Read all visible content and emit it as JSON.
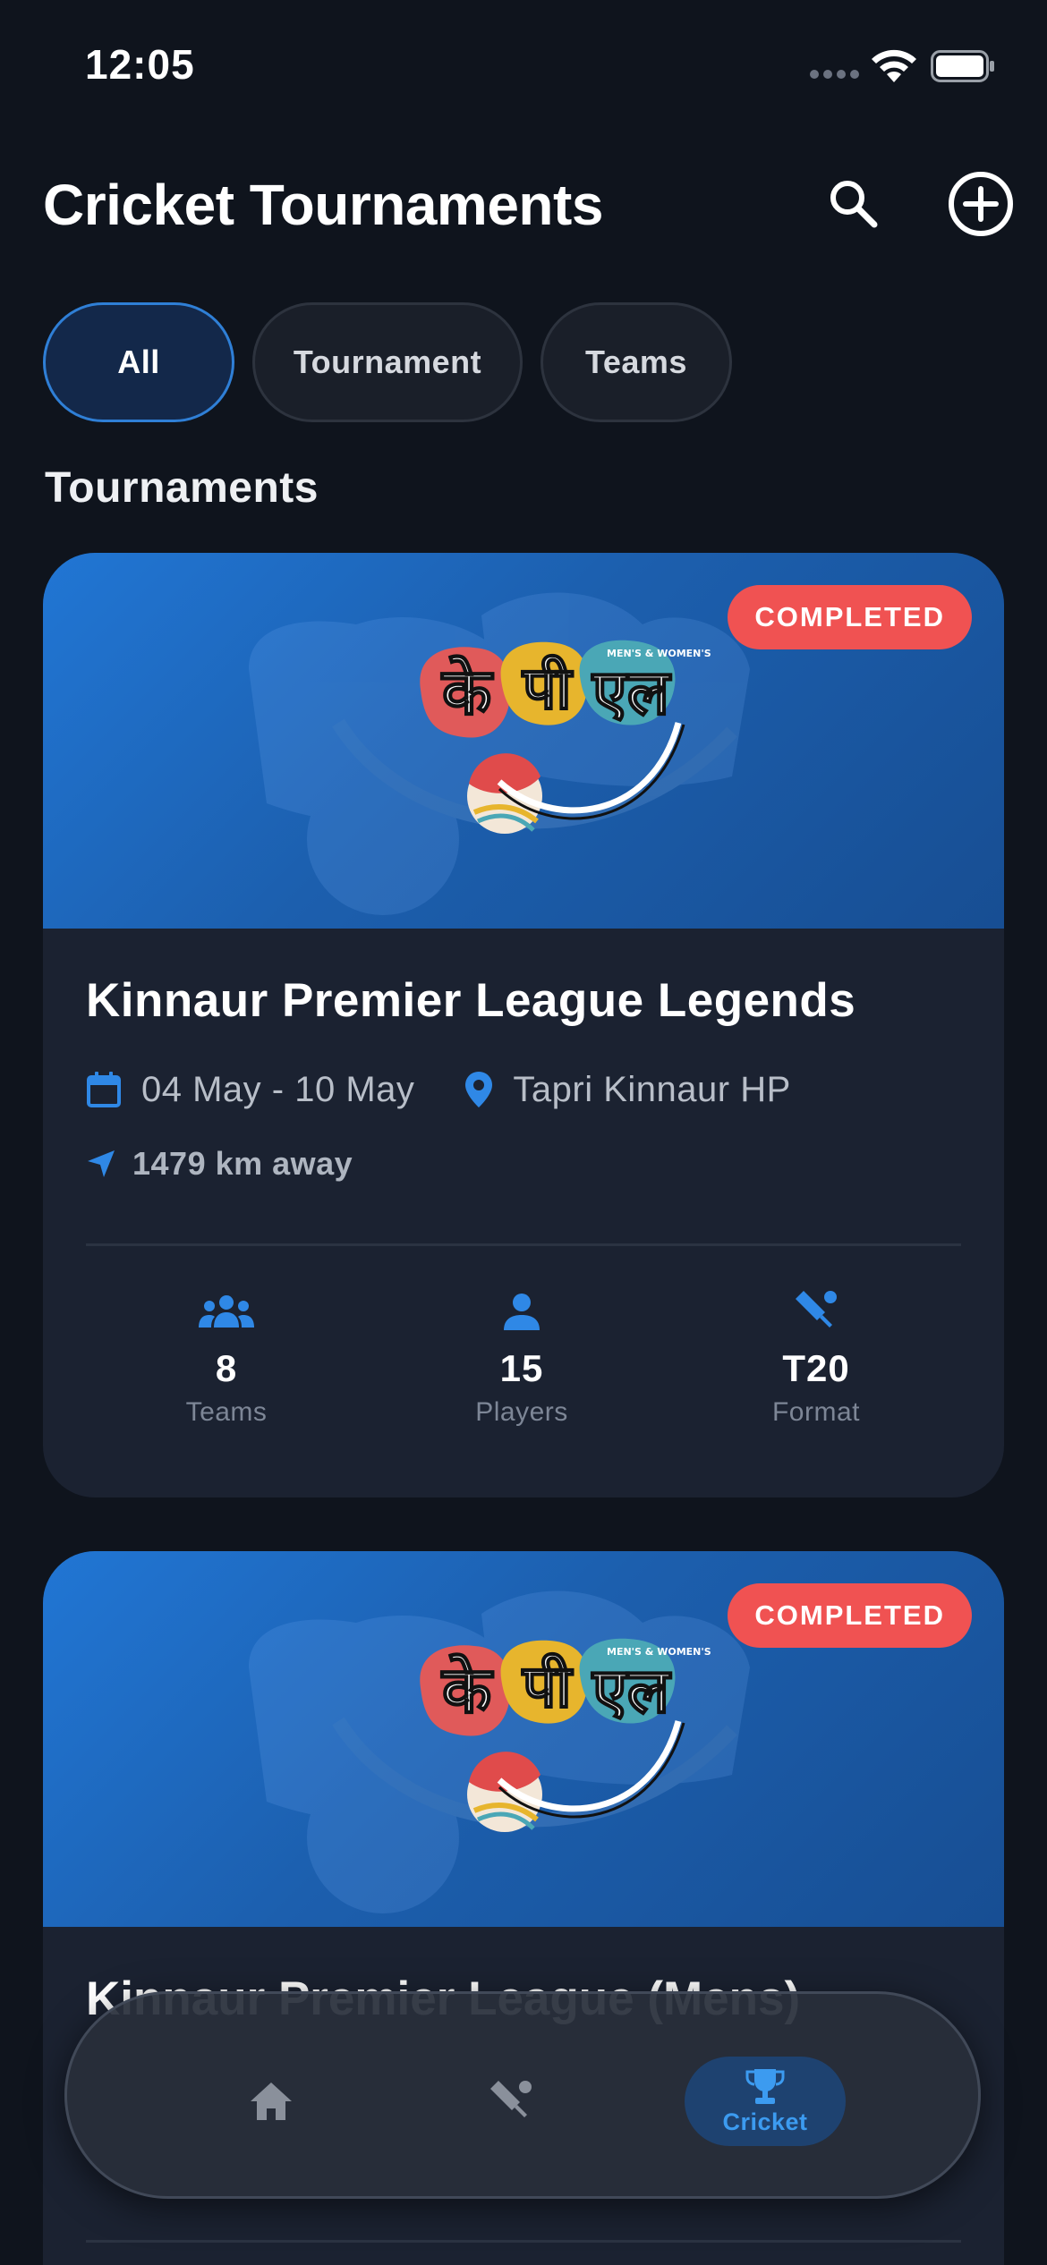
{
  "status_bar": {
    "time": "12:05"
  },
  "header": {
    "title": "Cricket Tournaments"
  },
  "filters": [
    {
      "label": "All",
      "active": true
    },
    {
      "label": "Tournament",
      "active": false
    },
    {
      "label": "Teams",
      "active": false
    }
  ],
  "section_title": "Tournaments",
  "banner_logo_text": [
    "के",
    "पी",
    "एल",
    "MEN'S & WOMEN'S"
  ],
  "tournaments": [
    {
      "status": "COMPLETED",
      "title": "Kinnaur Premier League Legends",
      "dates": "04 May - 10 May",
      "location": "Tapri Kinnaur HP",
      "distance": "1479 km away",
      "stats": [
        {
          "icon": "group-icon",
          "value": "8",
          "label": "Teams"
        },
        {
          "icon": "person-icon",
          "value": "15",
          "label": "Players"
        },
        {
          "icon": "cricket-bat-icon",
          "value": "T20",
          "label": "Format"
        }
      ]
    },
    {
      "status": "COMPLETED",
      "title": "Kinnaur Premier League (Mens)"
    }
  ],
  "bottom_nav": [
    {
      "icon": "home-icon",
      "label": ""
    },
    {
      "icon": "cricket-bat-icon",
      "label": ""
    },
    {
      "icon": "trophy-icon",
      "label": "Cricket",
      "active": true
    }
  ],
  "colors": {
    "background": "#0f141d",
    "card": "#1b2231",
    "accent": "#2f7fd6",
    "badge": "#f05252"
  }
}
